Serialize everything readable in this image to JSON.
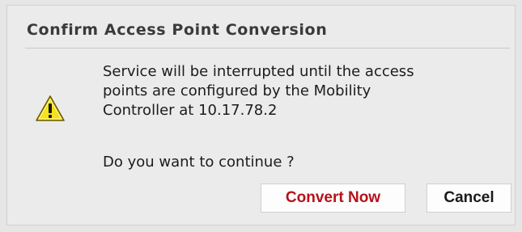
{
  "dialog": {
    "title": "Confirm Access Point Conversion",
    "icon": "warning-icon",
    "message_lines": [
      "Service will be interrupted until the access",
      "points are configured by the Mobility",
      "Controller at 10.17.78.2"
    ],
    "question": "Do you want to continue ?",
    "buttons": {
      "convert_label": "Convert Now",
      "cancel_label": "Cancel"
    }
  },
  "colors": {
    "warning_fill": "#f6e21a",
    "convert_text": "#b5121b",
    "title_text": "#3a3a3a"
  }
}
